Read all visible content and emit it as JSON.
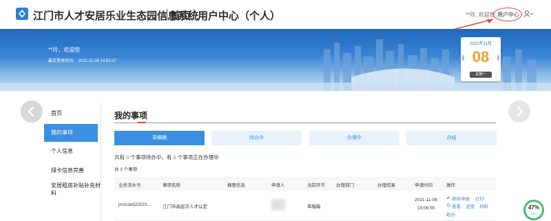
{
  "header": {
    "app_title": "江门市人才安居乐业生态园信息系统",
    "nav_home": "首页",
    "nav_user_center": "用户中心（个人）",
    "welcome": "**玲, 欢迎您",
    "user_center_link": "用户中心"
  },
  "banner": {
    "user_greeting": "**玲，欢迎您",
    "last_login": "最近登录时间： 2021-11-08 14:52:37",
    "calendar": {
      "year_month": "2021年11月",
      "day": "08",
      "weekday": "星期一"
    }
  },
  "sidebar": {
    "items": [
      {
        "label": "首页",
        "active": false
      },
      {
        "label": "我的事项",
        "active": true
      },
      {
        "label": "个人信息",
        "active": false
      },
      {
        "label": "绿卡信息完善",
        "active": false
      },
      {
        "label": "安居租房补贴补充材料",
        "active": false
      }
    ]
  },
  "main": {
    "title": "我的事项",
    "tabs": [
      {
        "label": "草稿箱",
        "active": true
      },
      {
        "label": "待办中",
        "active": false
      },
      {
        "label": "办理中",
        "active": false
      },
      {
        "label": "办结",
        "active": false
      }
    ],
    "summary": {
      "prefix": "共有",
      "pending_count": "0",
      "mid": "个事项待办中，有",
      "processing_count": "0",
      "suffix": "个事项正在办理中"
    },
    "count_text": "共 3 个事项",
    "columns": [
      "业务流水号",
      "事项名称",
      "摘要信息",
      "申请人",
      "当前环节",
      "办理部门",
      "办理结果",
      "申请时间",
      "操作"
    ],
    "rows": [
      {
        "serial": "jmzcdx522021...",
        "item_name": "江门市高层次人才认定",
        "summary": "",
        "applicant": "",
        "stage": "草稿箱",
        "department": "",
        "result": "",
        "date": "2021-11-08",
        "time": "15:06:55",
        "ops": [
          "继续申报",
          "打印",
          "查看",
          "进度",
          "材料",
          "取办"
        ]
      }
    ]
  },
  "widget": {
    "percent": "47%",
    "temp": "48°C",
    "accent": "#4cbb6c"
  },
  "colors": {
    "primary": "#3a8fe0",
    "accent_red": "#e0483b",
    "calendar_day": "#f0a020"
  }
}
